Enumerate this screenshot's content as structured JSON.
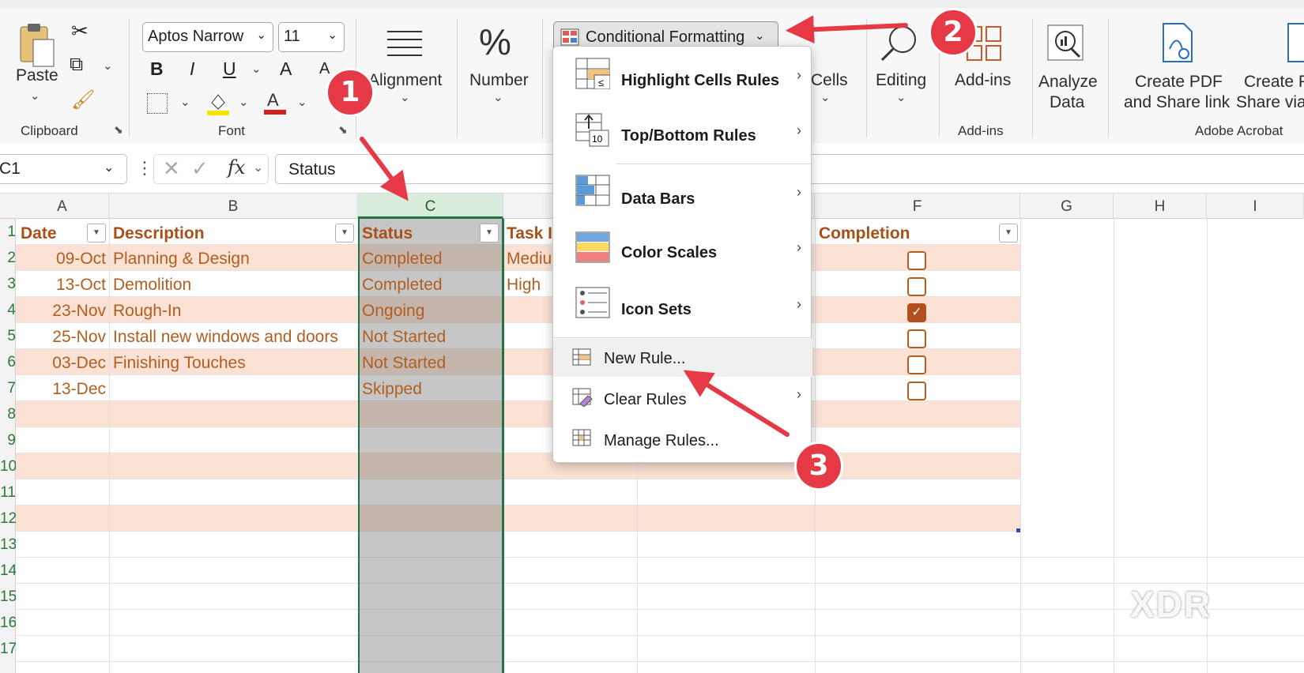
{
  "ribbon": {
    "clipboard": {
      "paste_label": "Paste",
      "group_label": "Clipboard"
    },
    "font": {
      "font_name": "Aptos Narrow",
      "font_size": "11",
      "bold": "B",
      "italic": "I",
      "underline": "U",
      "grow": "A",
      "shrink": "A",
      "group_label": "Font"
    },
    "alignment_label": "Alignment",
    "number_label": "Number",
    "conditional_formatting_label": "Conditional Formatting",
    "cells_label": "Cells",
    "editing_label": "Editing",
    "addins_label": "Add-ins",
    "addins_group_label": "Add-ins",
    "analyze_label_1": "Analyze",
    "analyze_label_2": "Data",
    "create_pdf_1": "Create PDF",
    "create_pdf_2": "and Share link",
    "create_pdf_b_1": "Create P",
    "create_pdf_b_2": "Share via",
    "adobe_group_label": "Adobe Acrobat",
    "number_glyph": "%"
  },
  "formula_bar": {
    "name_box": "C1",
    "fx": "fx",
    "content": "Status"
  },
  "columns": [
    "A",
    "B",
    "C",
    "",
    "",
    "F",
    "G",
    "H",
    "I"
  ],
  "row_numbers": [
    "1",
    "2",
    "3",
    "4",
    "5",
    "6",
    "7",
    "8",
    "9",
    "10",
    "11",
    "12",
    "13",
    "14",
    "15",
    "16",
    "17"
  ],
  "table": {
    "headers": {
      "date": "Date",
      "description": "Description",
      "status": "Status",
      "task": "Task I",
      "completion": "Completion"
    },
    "rows": [
      {
        "date": "09-Oct",
        "description": "Planning & Design",
        "status": "Completed",
        "task": "Mediu",
        "done": false
      },
      {
        "date": "13-Oct",
        "description": "Demolition",
        "status": "Completed",
        "task": "High",
        "done": false
      },
      {
        "date": "23-Nov",
        "description": "Rough-In",
        "status": "Ongoing",
        "task": "",
        "done": true
      },
      {
        "date": "25-Nov",
        "description": "Install new windows and doors",
        "status": "Not Started",
        "task": "",
        "done": false
      },
      {
        "date": "03-Dec",
        "description": "Finishing Touches",
        "status": "Not Started",
        "task": "",
        "done": false
      },
      {
        "date": "13-Dec",
        "description": "",
        "status": "Skipped",
        "task": "",
        "done": false
      }
    ]
  },
  "menu": {
    "items": [
      {
        "label": "Highlight Cells Rules",
        "icon": "highlight-cells-icon"
      },
      {
        "label": "Top/Bottom Rules",
        "icon": "top-bottom-icon"
      },
      {
        "label": "Data Bars",
        "icon": "data-bars-icon"
      },
      {
        "label": "Color Scales",
        "icon": "color-scales-icon"
      },
      {
        "label": "Icon Sets",
        "icon": "icon-sets-icon"
      },
      {
        "label": "New Rule...",
        "icon": "new-rule-icon"
      },
      {
        "label": "Clear Rules",
        "icon": "clear-rules-icon"
      },
      {
        "label": "Manage Rules...",
        "icon": "manage-rules-icon"
      }
    ],
    "topbottom_icon_text": "10"
  },
  "annotations": {
    "badge1": "1",
    "badge2": "2",
    "badge3": "3"
  },
  "watermark": "XDR",
  "colors": {
    "accent_red": "#e63946",
    "header_text": "#a9501a",
    "band": "#fbe2d5"
  }
}
